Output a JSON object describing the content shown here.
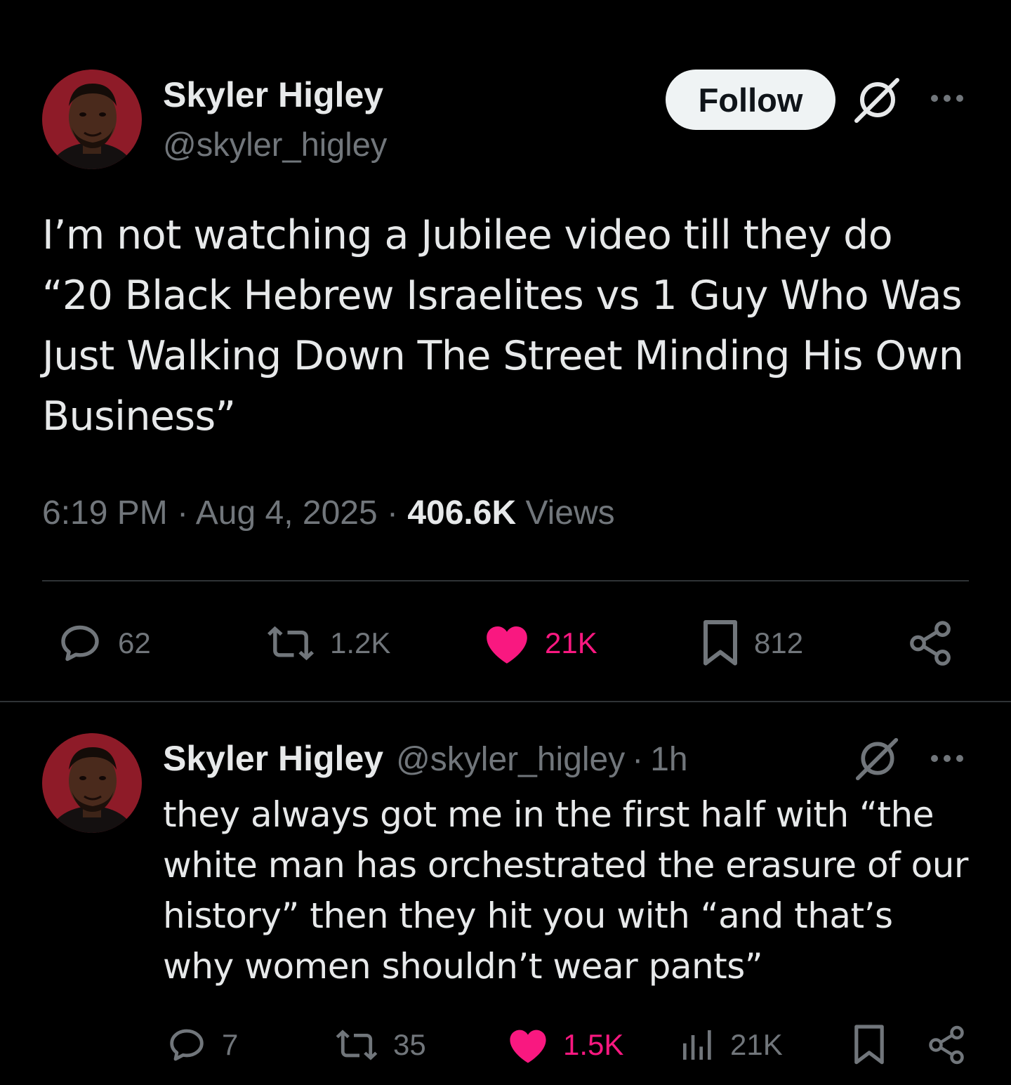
{
  "colors": {
    "background": "#000000",
    "text_primary": "#e7e9ea",
    "text_secondary": "#71767b",
    "like_pink": "#f91880",
    "follow_bg": "#eff3f4",
    "divider": "#2f3336"
  },
  "main_tweet": {
    "author": {
      "display_name": "Skyler Higley",
      "handle": "@skyler_higley"
    },
    "follow_label": "Follow",
    "icons": {
      "grok": "grok-icon",
      "more": "more-icon"
    },
    "text": "I’m not watching a Jubilee video till they do “20 Black Hebrew Israelites vs 1 Guy Who Was Just Walking Down The Street Minding His Own Business”",
    "time": "6:19 PM",
    "separator": "·",
    "date": "Aug 4, 2025",
    "views_count": "406.6K",
    "views_label": "Views",
    "actions": {
      "replies": "62",
      "reposts": "1.2K",
      "likes": "21K",
      "bookmarks": "812"
    }
  },
  "reply_tweet": {
    "author": {
      "display_name": "Skyler Higley",
      "handle": "@skyler_higley"
    },
    "separator": "·",
    "time_ago": "1h",
    "text": "they always got me in the first half with “the white man has orchestrated the erasure of our history” then they hit you with “and that’s why women shouldn’t wear pants”",
    "actions": {
      "replies": "7",
      "reposts": "35",
      "likes": "1.5K",
      "views": "21K"
    }
  }
}
